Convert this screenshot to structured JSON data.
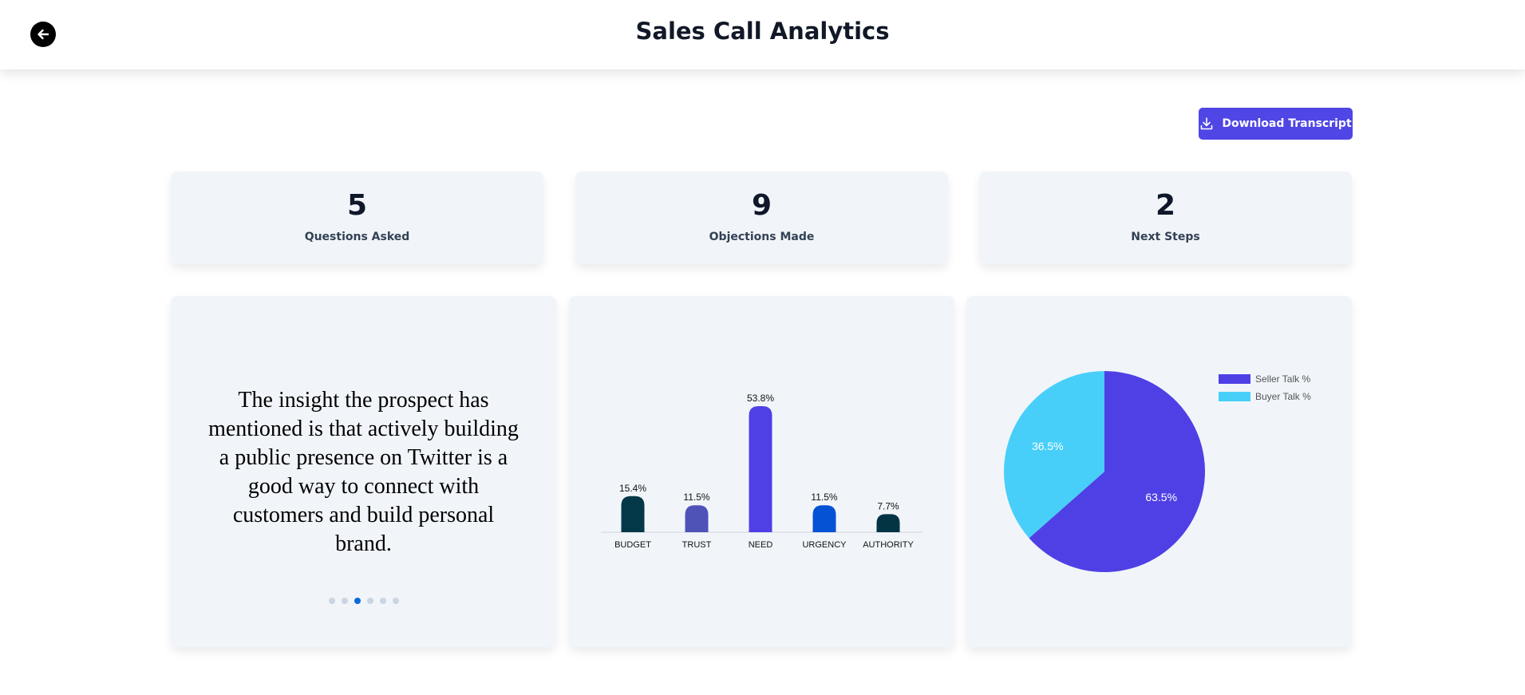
{
  "header": {
    "title": "Sales Call Analytics"
  },
  "toolbar": {
    "download_label": "Download Transcript"
  },
  "stats": [
    {
      "value": "5",
      "label": "Questions Asked"
    },
    {
      "value": "9",
      "label": "Objections Made"
    },
    {
      "value": "2",
      "label": "Next Steps"
    }
  ],
  "insights": {
    "text": "The insight the prospect has mentioned is that actively building a public presence on Twitter is a good way to connect with customers and build personal brand.",
    "slide_count": 6,
    "active_index": 2
  },
  "colors": {
    "accent": "#4f46e5",
    "card": "#f1f5f9",
    "dot_active": "#0b6bd8"
  },
  "chart_data": [
    {
      "type": "bar",
      "categories": [
        "BUDGET",
        "TRUST",
        "NEED",
        "URGENCY",
        "AUTHORITY"
      ],
      "values": [
        15.4,
        11.5,
        53.8,
        11.5,
        7.7
      ],
      "labels": [
        "15.4%",
        "11.5%",
        "53.8%",
        "11.5%",
        "7.7%"
      ],
      "colors": [
        "#023848",
        "#4f53b8",
        "#4f40e6",
        "#0453d4",
        "#023444"
      ],
      "title": "",
      "xlabel": "",
      "ylabel": "",
      "ylim": [
        0,
        53.8
      ],
      "grid": false
    },
    {
      "type": "pie",
      "series": [
        {
          "name": "Seller Talk %",
          "value": 63.5,
          "label": "63.5%",
          "color": "#4f40e6"
        },
        {
          "name": "Buyer Talk %",
          "value": 36.5,
          "label": "36.5%",
          "color": "#48cff9"
        }
      ],
      "legend": "top-right"
    }
  ]
}
